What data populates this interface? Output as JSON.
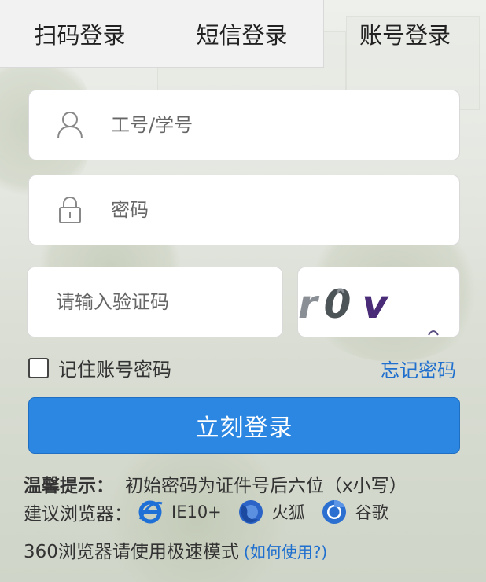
{
  "tabs": [
    {
      "label": "扫码登录"
    },
    {
      "label": "短信登录"
    },
    {
      "label": "账号登录"
    }
  ],
  "form": {
    "username_placeholder": "工号/学号",
    "password_placeholder": "密码",
    "captcha_placeholder": "请输入验证码",
    "captcha_text": "r0v",
    "remember_label": "记住账号密码",
    "forgot_label": "忘记密码",
    "login_label": "立刻登录"
  },
  "tips": {
    "hint_label": "温馨提示：",
    "hint_text": "初始密码为证件号后六位（x小写）",
    "browser_label": "建议浏览器：",
    "browsers": [
      {
        "name": "IE10+",
        "icon": "ie-icon"
      },
      {
        "name": "火狐",
        "icon": "firefox-icon"
      },
      {
        "name": "谷歌",
        "icon": "chrome-icon"
      }
    ],
    "speed_text": "360浏览器请使用极速模式",
    "how_link": "(如何使用?)"
  },
  "colors": {
    "accent": "#2c87e2",
    "link": "#1f6fcf"
  }
}
